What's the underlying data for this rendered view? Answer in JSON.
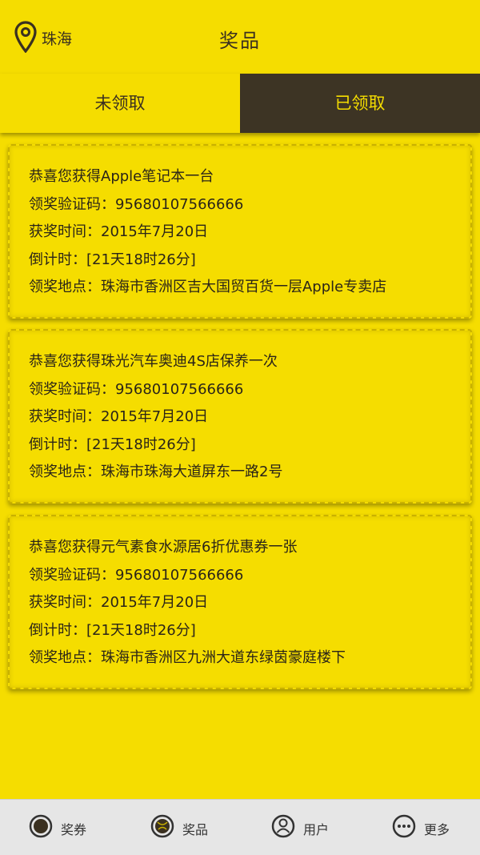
{
  "header": {
    "city": "珠海",
    "title": "奖品"
  },
  "tabs": [
    {
      "label": "未领取",
      "active": false
    },
    {
      "label": "已领取",
      "active": true
    }
  ],
  "prizes": [
    {
      "title": "恭喜您获得Apple笔记本一台",
      "code": "领奖验证码：95680107566666",
      "time": "获奖时间：2015年7月20日",
      "countdown": "倒计时：[21天18时26分]",
      "location": "领奖地点：珠海市香洲区吉大国贸百货一层Apple专卖店"
    },
    {
      "title": "恭喜您获得珠光汽车奥迪4S店保养一次",
      "code": "领奖验证码：95680107566666",
      "time": "获奖时间：2015年7月20日",
      "countdown": "倒计时：[21天18时26分]",
      "location": "领奖地点：珠海市珠海大道屏东一路2号"
    },
    {
      "title": "恭喜您获得元气素食水源居6折优惠券一张",
      "code": "领奖验证码：95680107566666",
      "time": "获奖时间：2015年7月20日",
      "countdown": "倒计时：[21天18时26分]",
      "location": "领奖地点：珠海市香洲区九洲大道东绿茵豪庭楼下"
    }
  ],
  "bottom_nav": [
    {
      "label": "奖券",
      "icon": "coupon-icon"
    },
    {
      "label": "奖品",
      "icon": "prize-icon"
    },
    {
      "label": "用户",
      "icon": "user-icon"
    },
    {
      "label": "更多",
      "icon": "more-icon"
    }
  ],
  "colors": {
    "background": "#f5dd00",
    "active_tab": "#3d3424",
    "active_tab_text": "#f5dd00",
    "nav_background": "#e6e6e6"
  }
}
